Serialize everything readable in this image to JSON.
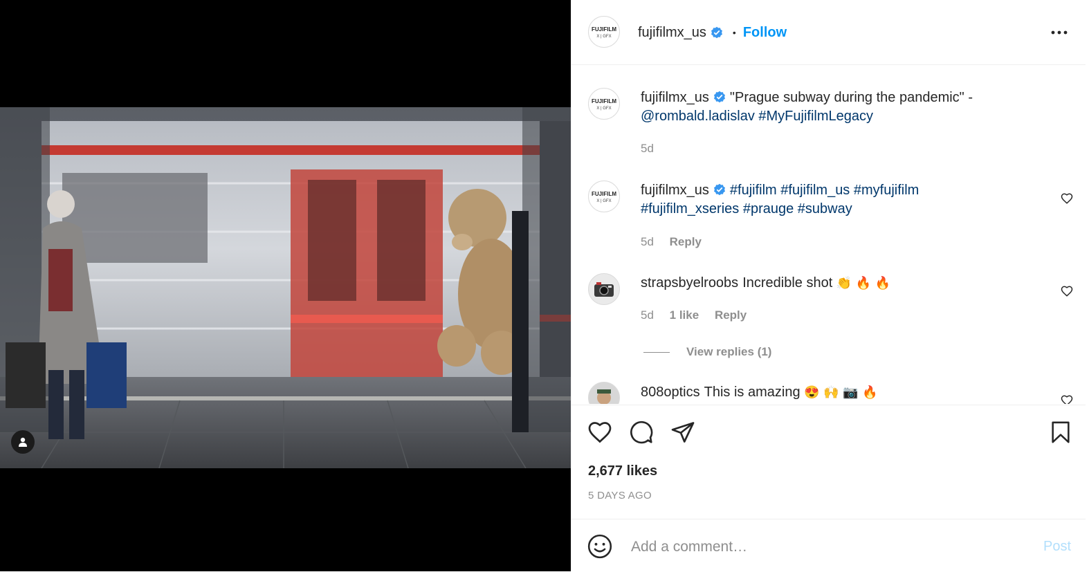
{
  "post": {
    "username": "fujifilmx_us",
    "follow_label": "Follow",
    "separator": "•",
    "more_icon": "more-horizontal-icon",
    "logo_text_top": "FUJIFILM",
    "logo_text_bottom": "X | GFX"
  },
  "caption": {
    "username": "fujifilmx_us",
    "text": "\"Prague subway during the pandemic\" -",
    "mention": "@rombald.ladislav",
    "hashtag": "#MyFujifilmLegacy",
    "time": "5d"
  },
  "comments": [
    {
      "username": "fujifilmx_us",
      "line1": "#fujifilm #fujifilm_us #myfujifilm",
      "line2": "#fujifilm_xseries #prauge #subway",
      "time": "5d",
      "reply_label": "Reply"
    },
    {
      "username": "strapsbyelroobs",
      "text": "Incredible shot",
      "emojis": [
        "👏",
        "🔥",
        "🔥"
      ],
      "time": "5d",
      "likes": "1 like",
      "reply_label": "Reply",
      "view_replies": "View replies (1)"
    },
    {
      "username": "808optics",
      "text": "This is amazing",
      "emojis": [
        "😍",
        "🙌",
        "📷",
        "🔥"
      ]
    }
  ],
  "actions": {
    "likes": "2,677 likes",
    "posted_ago": "5 DAYS AGO"
  },
  "add_comment": {
    "placeholder": "Add a comment…",
    "post_label": "Post"
  },
  "colors": {
    "link": "#0095f6",
    "hashtag": "#00376b",
    "verified": "#3897f0",
    "post_disabled": "#b2dffc"
  }
}
